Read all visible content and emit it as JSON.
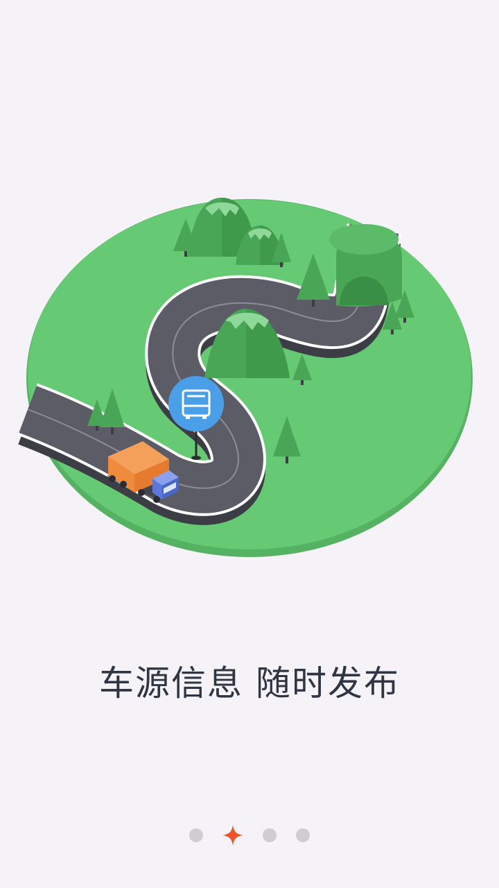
{
  "onboarding": {
    "headline": "车源信息  随时发布",
    "current_page_index": 1,
    "page_count": 4
  },
  "colors": {
    "background": "#f5f3f7",
    "grass": "#66c974",
    "road": "#5b5c66",
    "pin": "#4a9fe8",
    "active_indicator": "#f0502a",
    "inactive_indicator": "#cfcdd1",
    "text": "#2f3542"
  },
  "icons": {
    "pin_icon": "bus-icon",
    "truck": "truck-icon"
  }
}
